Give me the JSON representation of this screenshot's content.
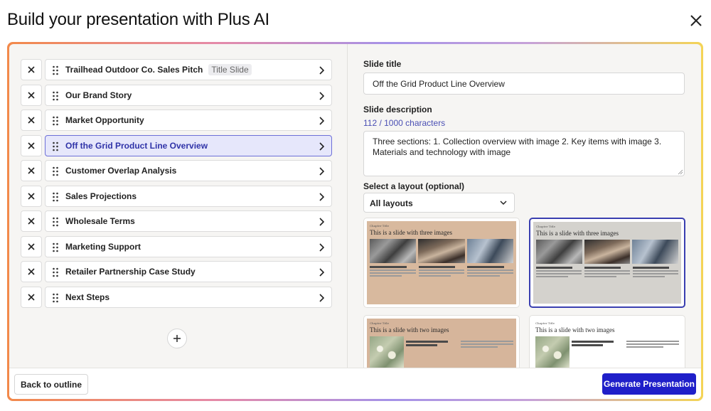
{
  "header": {
    "title": "Build your presentation with Plus AI",
    "close_icon": "close-icon"
  },
  "outline": {
    "slides": [
      {
        "label": "Trailhead Outdoor Co. Sales Pitch",
        "tag": "Title Slide",
        "selected": false
      },
      {
        "label": "Our Brand Story",
        "tag": "",
        "selected": false
      },
      {
        "label": "Market Opportunity",
        "tag": "",
        "selected": false
      },
      {
        "label": "Off the Grid Product Line Overview",
        "tag": "",
        "selected": true
      },
      {
        "label": "Customer Overlap Analysis",
        "tag": "",
        "selected": false
      },
      {
        "label": "Sales Projections",
        "tag": "",
        "selected": false
      },
      {
        "label": "Wholesale Terms",
        "tag": "",
        "selected": false
      },
      {
        "label": "Marketing Support",
        "tag": "",
        "selected": false
      },
      {
        "label": "Retailer Partnership Case Study",
        "tag": "",
        "selected": false
      },
      {
        "label": "Next Steps",
        "tag": "",
        "selected": false
      }
    ],
    "add_icon": "plus-icon"
  },
  "editor": {
    "title_label": "Slide title",
    "title_value": "Off the Grid Product Line Overview",
    "description_label": "Slide description",
    "description_counter": "112 / 1000 characters",
    "description_value": "Three sections: 1. Collection overview with image 2. Key items with image 3. Materials and technology with image",
    "layout_label": "Select a layout (optional)",
    "layout_selected": "All layouts"
  },
  "layouts": [
    {
      "kicker": "Chapter Title",
      "title": "This is a slide with three images",
      "bg": "#d8b99e",
      "selected": false
    },
    {
      "kicker": "Chapter Title",
      "title": "This is a slide with three images",
      "bg": "#d4d2cd",
      "selected": true
    },
    {
      "kicker": "Chapter Title",
      "title": "This is a slide with two images",
      "bg": "#d6b59b",
      "selected": false
    },
    {
      "kicker": "Chapter Title",
      "title": "This is a slide with two images",
      "bg": "#ffffff",
      "selected": false
    }
  ],
  "footer": {
    "back_label": "Back to outline",
    "generate_label": "Generate Presentation"
  },
  "colors": {
    "accent": "#1f1fc9",
    "selected_row_bg": "#e6e7fb",
    "selected_row_border": "#6d6fd8"
  }
}
